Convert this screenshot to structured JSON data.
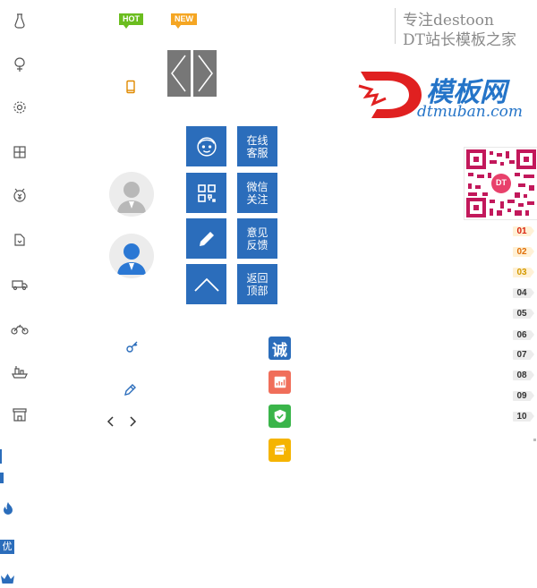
{
  "badges": {
    "hot": "HOT",
    "new": "NEW"
  },
  "brand": {
    "line1": "专注destoon",
    "line2": "DT站长模板之家",
    "logo_cn": "模板网",
    "logo_en": "dtmuban.com",
    "qr_badge": "DT"
  },
  "service": [
    {
      "label": "在线客服",
      "icon": "customer-service-icon"
    },
    {
      "label": "微信关注",
      "icon": "qr-code-icon"
    },
    {
      "label": "意见反馈",
      "icon": "pencil-icon"
    },
    {
      "label": "返回顶部",
      "icon": "chevron-up-icon"
    }
  ],
  "trust": {
    "cheng": "诚"
  },
  "ranks": [
    "01",
    "02",
    "03",
    "04",
    "05",
    "06",
    "07",
    "08",
    "09",
    "10"
  ],
  "left_labels": {
    "you": "优"
  },
  "colors": {
    "primary": "#2b6dbb",
    "hot": "#6bbd1f",
    "new": "#f5a623",
    "logo_red": "#e02020",
    "logo_blue": "#2474c8"
  }
}
